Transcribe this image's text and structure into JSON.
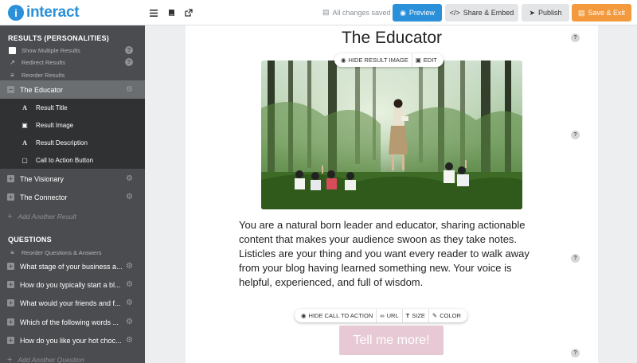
{
  "brand": {
    "name": "interact",
    "mark": "i"
  },
  "toolbar": {
    "saved_status": "All changes saved",
    "preview_label": "Preview",
    "share_label": "Share & Embed",
    "publish_label": "Publish",
    "save_exit_label": "Save & Exit"
  },
  "sidebar": {
    "results_header": "RESULTS (PERSONALITIES)",
    "results_options": [
      {
        "label": "Show Multiple Results",
        "icon": "checkbox-icon"
      },
      {
        "label": "Redirect Results",
        "icon": "external-link-icon"
      },
      {
        "label": "Reorder Results",
        "icon": "reorder-icon"
      }
    ],
    "active_result": "The Educator",
    "active_subitems": [
      {
        "label": "Result Title",
        "icon": "text-icon"
      },
      {
        "label": "Result Image",
        "icon": "image-icon"
      },
      {
        "label": "Result Description",
        "icon": "text-icon"
      },
      {
        "label": "Call to Action Button",
        "icon": "button-icon"
      }
    ],
    "other_results": [
      "The Visionary",
      "The Connector"
    ],
    "add_result": "Add Another Result",
    "questions_header": "QUESTIONS",
    "reorder_questions": "Reorder Questions & Answers",
    "questions": [
      "What stage of your business a...",
      "How do you typically start a bl...",
      "What would your friends and f...",
      "Which of the following words ...",
      "How do you like your hot choc..."
    ],
    "add_question": "Add Another Question"
  },
  "canvas": {
    "title": "The Educator",
    "image_toolbar": {
      "hide_label": "HIDE RESULT IMAGE",
      "edit_label": "EDIT"
    },
    "description": "You are a natural born leader and educator, sharing actionable content that makes your audience swoon as they take notes. Listicles are your thing and you want every reader to walk away from your blog having learned something new. Your voice is helpful, experienced, and full of wisdom.",
    "cta_toolbar": {
      "hide_label": "HIDE CALL TO ACTION",
      "url_label": "URL",
      "size_label": "SIZE",
      "color_label": "COLOR"
    },
    "cta_label": "Tell me more!",
    "help_glyph": "?"
  },
  "colors": {
    "accent": "#2a90d9",
    "save": "#f39a3e",
    "sidebar": "#4a4c4f",
    "cta": "#e6c9d4"
  }
}
